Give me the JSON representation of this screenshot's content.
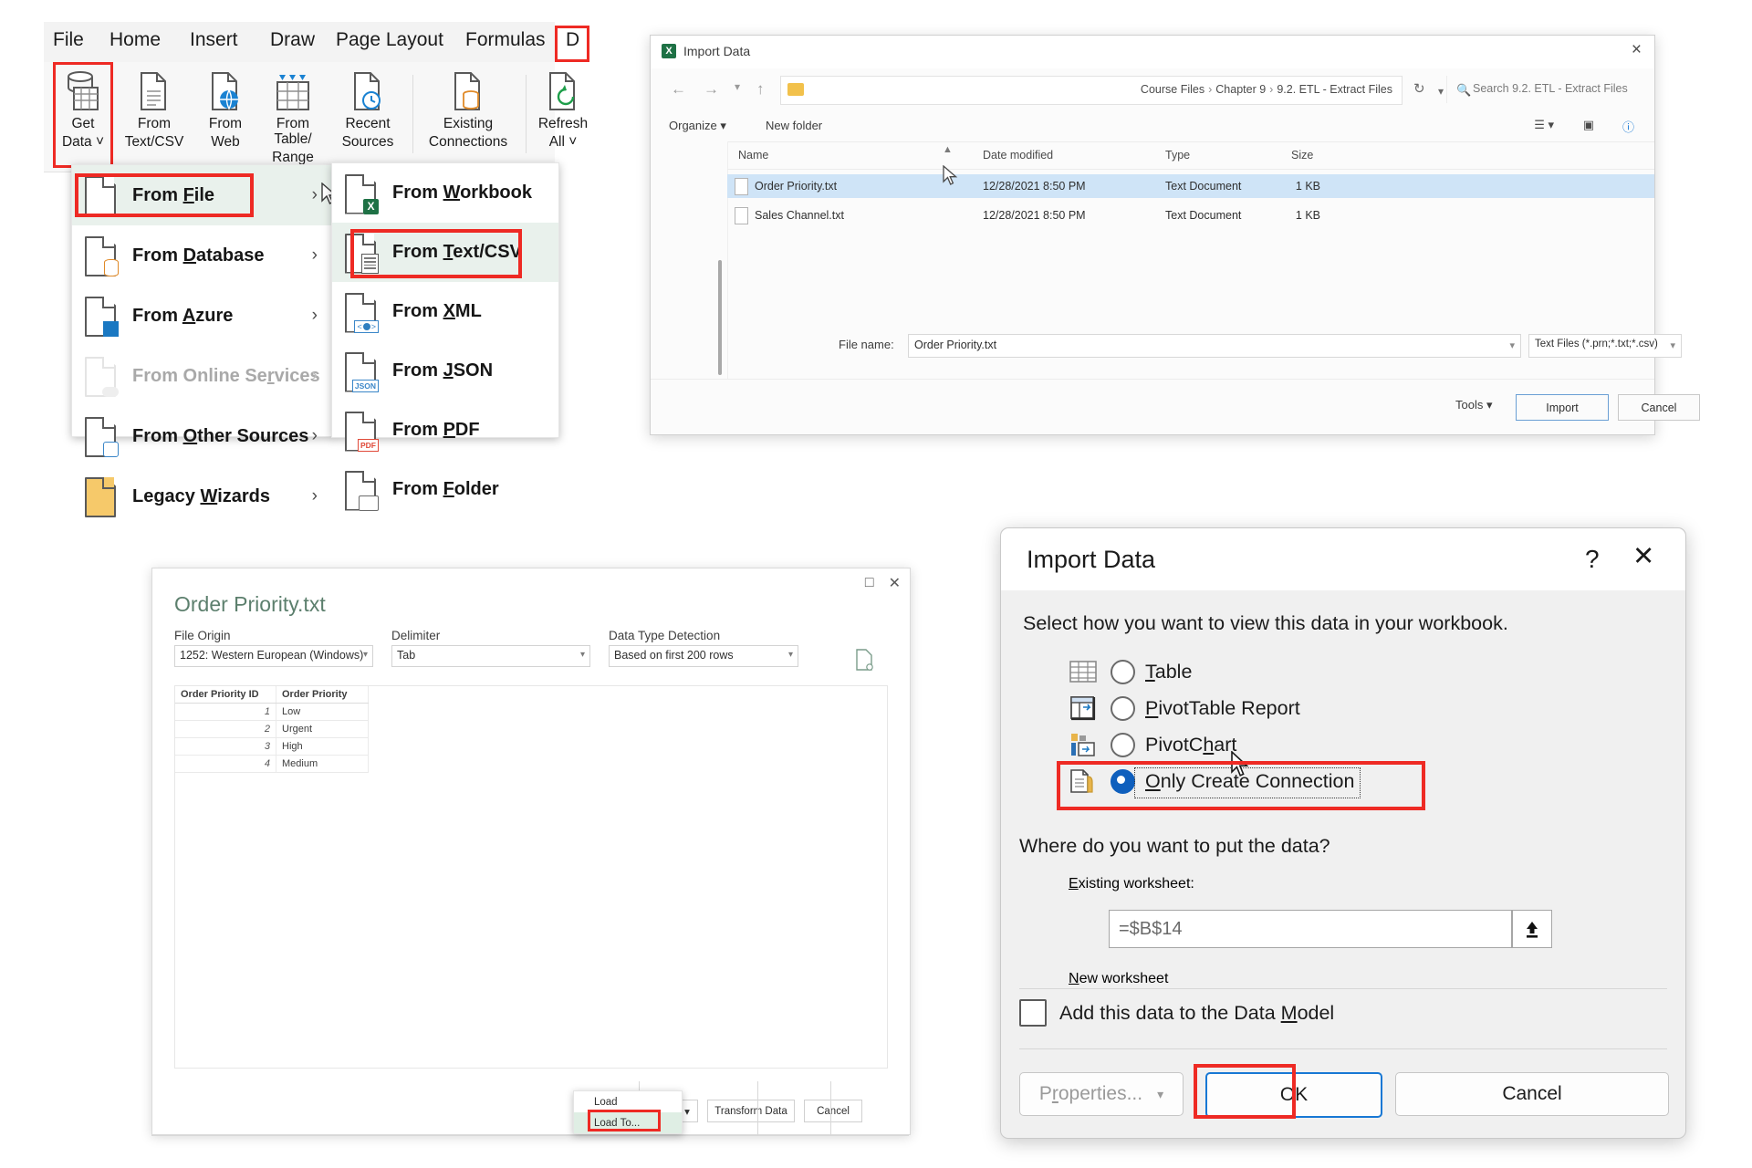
{
  "ribbon": {
    "tabs": [
      {
        "label": "File"
      },
      {
        "label": "Home"
      },
      {
        "label": "Insert"
      },
      {
        "label": "Draw"
      },
      {
        "label": "Page Layout"
      },
      {
        "label": "Formulas"
      },
      {
        "label": "D"
      }
    ],
    "buttons": [
      {
        "label": "Get\nData ˅",
        "line1": "Get",
        "line2": "Data ˅",
        "icon": "get-data-icon"
      },
      {
        "line1": "From",
        "line2": "Text/CSV",
        "icon": "from-text-csv-icon"
      },
      {
        "line1": "From",
        "line2": "Web",
        "icon": "from-web-icon"
      },
      {
        "line1": "From Table/",
        "line2": "Range",
        "icon": "from-table-range-icon"
      },
      {
        "line1": "Recent",
        "line2": "Sources",
        "icon": "recent-sources-icon"
      },
      {
        "line1": "Existing",
        "line2": "Connections",
        "icon": "existing-connections-icon"
      },
      {
        "line1": "Refresh",
        "line2": "All ˅",
        "icon": "refresh-all-icon"
      }
    ]
  },
  "get_data_menu": {
    "items": [
      {
        "label_pre": "From ",
        "label_key": "F",
        "label_post": "ile",
        "icon": "file-icon",
        "selected": true,
        "disabled": false
      },
      {
        "label_pre": "From ",
        "label_key": "D",
        "label_post": "atabase",
        "icon": "database-icon",
        "selected": false,
        "disabled": false
      },
      {
        "label_pre": "From ",
        "label_key": "A",
        "label_post": "zure",
        "icon": "azure-icon",
        "selected": false,
        "disabled": false
      },
      {
        "label_pre": "From Online Se",
        "label_key": "r",
        "label_post": "vices",
        "icon": "online-services-icon",
        "selected": false,
        "disabled": true
      },
      {
        "label_pre": "From ",
        "label_key": "O",
        "label_post": "ther Sources",
        "icon": "other-sources-icon",
        "selected": false,
        "disabled": false
      },
      {
        "label_pre": "Legacy ",
        "label_key": "W",
        "label_post": "izards",
        "icon": "legacy-wizards-icon",
        "selected": false,
        "disabled": false
      }
    ]
  },
  "from_file_submenu": {
    "items": [
      {
        "label_pre": "From ",
        "label_key": "W",
        "label_post": "orkbook",
        "icon": "workbook-icon",
        "selected": false
      },
      {
        "label_pre": "From ",
        "label_key": "T",
        "label_post": "ext/CSV",
        "icon": "text-csv-icon",
        "selected": true
      },
      {
        "label_pre": "From ",
        "label_key": "X",
        "label_post": "ML",
        "icon": "xml-icon",
        "selected": false
      },
      {
        "label_pre": "From ",
        "label_key": "J",
        "label_post": "SON",
        "icon": "json-icon",
        "selected": false
      },
      {
        "label_pre": "From ",
        "label_key": "P",
        "label_post": "DF",
        "icon": "pdf-icon",
        "selected": false
      },
      {
        "label_pre": "From ",
        "label_key": "F",
        "label_post": "older",
        "icon": "folder-icon",
        "selected": false
      }
    ]
  },
  "file_dialog": {
    "title": "Import Data",
    "close_label": "×",
    "breadcrumb": [
      "Course Files",
      "Chapter 9",
      "9.2. ETL - Extract Files"
    ],
    "search_placeholder": "Search 9.2. ETL - Extract Files",
    "organize_label": "Organize ▾",
    "new_folder_label": "New folder",
    "columns": [
      "Name",
      "Date modified",
      "Type",
      "Size"
    ],
    "rows": [
      {
        "name": "Order Priority.txt",
        "date": "12/28/2021 8:50 PM",
        "type": "Text Document",
        "size": "1 KB",
        "selected": true
      },
      {
        "name": "Sales Channel.txt",
        "date": "12/28/2021 8:50 PM",
        "type": "Text Document",
        "size": "1 KB",
        "selected": false
      }
    ],
    "file_name_label": "File name:",
    "file_name_value": "Order Priority.txt",
    "file_type_value": "Text Files (*.prn;*.txt;*.csv)",
    "tools_label": "Tools  ▾",
    "import_label": "Import",
    "cancel_label": "Cancel"
  },
  "preview": {
    "title": "Order Priority.txt",
    "maximize_label": "□",
    "close_label": "✕",
    "file_origin_label": "File Origin",
    "file_origin_value": "1252: Western European (Windows)",
    "delimiter_label": "Delimiter",
    "delimiter_value": "Tab",
    "detection_label": "Data Type Detection",
    "detection_value": "Based on first 200 rows",
    "columns": [
      "Order Priority ID",
      "Order Priority"
    ],
    "rows": [
      [
        "1",
        "Low"
      ],
      [
        "2",
        "Urgent"
      ],
      [
        "3",
        "High"
      ],
      [
        "4",
        "Medium"
      ]
    ],
    "load_label": "Load",
    "load_caret": "▾",
    "transform_label": "Transform Data",
    "cancel_label": "Cancel",
    "load_menu": [
      {
        "label": "Load",
        "selected": false
      },
      {
        "label": "Load To...",
        "selected": true
      }
    ]
  },
  "import_dialog": {
    "title": "Import Data",
    "help_label": "?",
    "close_label": "✕",
    "prompt": "Select how you want to view this data in your workbook.",
    "view_options": [
      {
        "pre": "",
        "key": "T",
        "post": "able",
        "selected": false,
        "icon": "table-icon"
      },
      {
        "pre": "",
        "key": "P",
        "post": "ivotTable Report",
        "selected": false,
        "icon": "pivottable-icon"
      },
      {
        "pre": "PivotC",
        "key": "h",
        "post": "art",
        "selected": false,
        "icon": "pivotchart-icon"
      },
      {
        "pre": "",
        "key": "O",
        "post": "nly Create Connection",
        "selected": true,
        "icon": "connection-icon"
      }
    ],
    "prompt2": "Where do you want to put the data?",
    "placement_options": [
      {
        "pre": "",
        "key": "E",
        "post": "xisting worksheet:",
        "selected": false,
        "disabled": true
      },
      {
        "pre": "",
        "key": "N",
        "post": "ew worksheet",
        "selected": true,
        "disabled": true
      }
    ],
    "reference_value": "=$B$14",
    "collapse_icon": "collapse-dialog-icon",
    "data_model_label_pre": "Add this data to the Data ",
    "data_model_key": "M",
    "data_model_label_post": "odel",
    "data_model_checked": false,
    "properties_label_pre": "P",
    "properties_key": "r",
    "properties_label_post": "operties...",
    "properties_caret": "▾",
    "ok_label": "OK",
    "cancel_label": "Cancel"
  },
  "colors": {
    "highlight_red": "#ee2a24",
    "accent_blue": "#1878d4",
    "excel_green": "#1e7145",
    "menu_selected": "#e9f1ec",
    "file_selected": "#cfe4f7"
  }
}
